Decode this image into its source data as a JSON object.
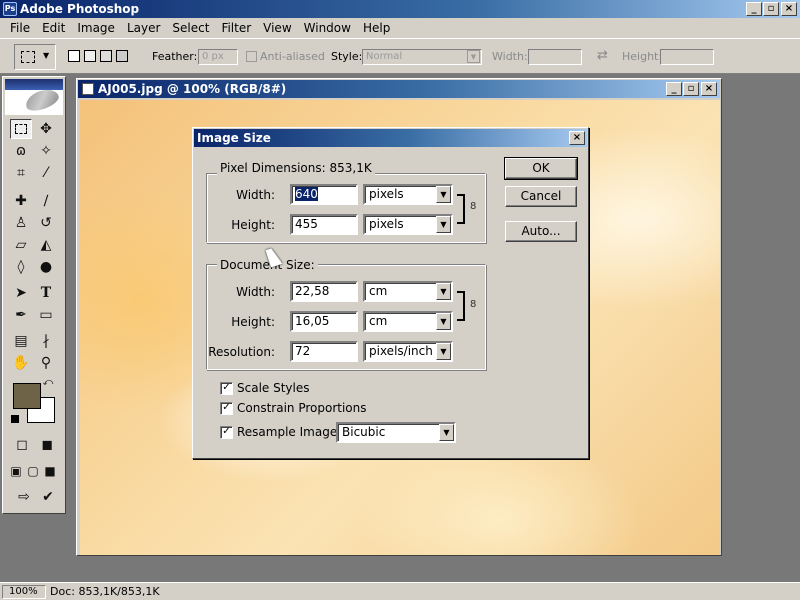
{
  "app": {
    "title": "Adobe Photoshop",
    "logo_icon": "photoshop-icon"
  },
  "window_buttons": {
    "minimize": "_",
    "restore": "▫",
    "close": "×"
  },
  "menubar": {
    "items": [
      "File",
      "Edit",
      "Image",
      "Layer",
      "Select",
      "Filter",
      "View",
      "Window",
      "Help"
    ]
  },
  "options_bar": {
    "feather_label": "Feather:",
    "feather_value": "0 px",
    "anti_aliased_label": "Anti-aliased",
    "style_label": "Style:",
    "style_value": "Normal",
    "width_label": "Width:",
    "height_label": "Height:",
    "swap_icon": "swap-arrows-icon"
  },
  "document": {
    "title": "AJ005.jpg @ 100% (RGB/8#)"
  },
  "dialog": {
    "title": "Image Size",
    "pixel_dimensions": {
      "label": "Pixel Dimensions:",
      "size": "853,1K",
      "width_label": "Width:",
      "width_value": "640",
      "width_unit": "pixels",
      "height_label": "Height:",
      "height_value": "455",
      "height_unit": "pixels"
    },
    "document_size": {
      "label": "Document Size:",
      "width_label": "Width:",
      "width_value": "22,58",
      "width_unit": "cm",
      "height_label": "Height:",
      "height_value": "16,05",
      "height_unit": "cm",
      "resolution_label": "Resolution:",
      "resolution_value": "72",
      "resolution_unit": "pixels/inch"
    },
    "checkboxes": {
      "scale_styles": {
        "label": "Scale Styles",
        "checked": true
      },
      "constrain_proportions": {
        "label": "Constrain Proportions",
        "checked": true
      },
      "resample_image": {
        "label": "Resample Image:",
        "checked": true,
        "method": "Bicubic"
      }
    },
    "buttons": {
      "ok": "OK",
      "cancel": "Cancel",
      "auto": "Auto..."
    },
    "check_mark": "✓"
  },
  "status_bar": {
    "zoom": "100%",
    "doc_info": "Doc: 853,1K/853,1K"
  },
  "colors": {
    "foreground": "#6e6247",
    "background": "#ffffff",
    "title_active": "#0a246a"
  }
}
